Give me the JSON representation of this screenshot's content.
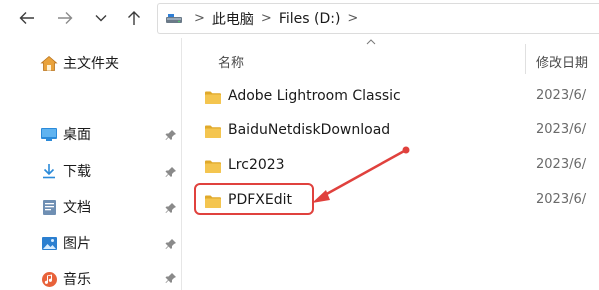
{
  "nav": {
    "back_icon": "arrow-left-icon",
    "forward_icon": "arrow-right-icon",
    "recent_icon": "chevron-down-icon",
    "up_icon": "arrow-up-icon"
  },
  "address": {
    "drive_icon": "drive-icon",
    "crumbs": [
      "此电脑",
      "Files (D:)"
    ],
    "separator": ">"
  },
  "sidebar": {
    "home": {
      "label": "主文件夹",
      "icon": "home-icon"
    },
    "items": [
      {
        "label": "桌面",
        "icon": "desktop-icon",
        "pinned": true
      },
      {
        "label": "下载",
        "icon": "download-icon",
        "pinned": true
      },
      {
        "label": "文档",
        "icon": "document-icon",
        "pinned": true
      },
      {
        "label": "图片",
        "icon": "picture-icon",
        "pinned": true
      },
      {
        "label": "音乐",
        "icon": "music-icon",
        "pinned": true
      }
    ]
  },
  "columns": {
    "name": "名称",
    "date": "修改日期"
  },
  "files": [
    {
      "name": "Adobe Lightroom Classic",
      "date": "2023/6/"
    },
    {
      "name": "BaiduNetdiskDownload",
      "date": "2023/6/"
    },
    {
      "name": "Lrc2023",
      "date": "2023/6/"
    },
    {
      "name": "PDFXEdit",
      "date": "2023/6/",
      "highlighted": true
    }
  ],
  "annotation": {
    "color": "#e0413d",
    "target": "PDFXEdit"
  },
  "colors": {
    "folder": "#f2c34a",
    "folder_dark": "#e0a92a",
    "accent": "#0f6cbd"
  }
}
